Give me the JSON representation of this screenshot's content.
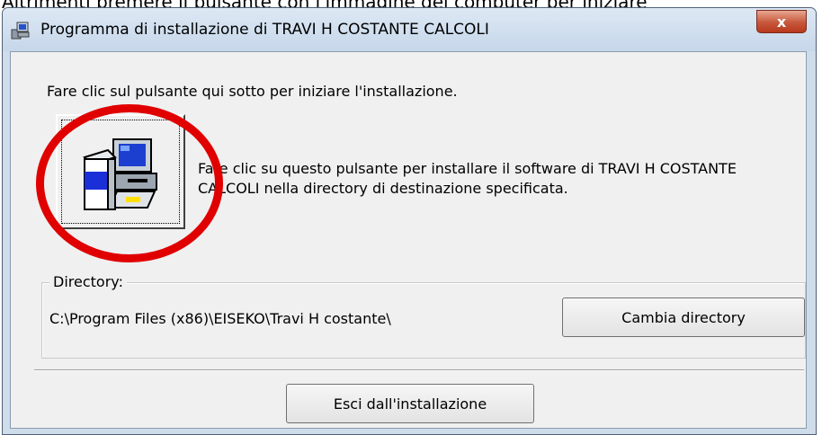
{
  "caption": "Altrimenti premere il pulsante con l'immagine del computer per iniziare",
  "window": {
    "title": "Programma di installazione di TRAVI H COSTANTE CALCOLI",
    "icon": "installer-icon",
    "close_label": "x"
  },
  "content": {
    "intro": "Fare clic sul pulsante qui sotto per iniziare l'installazione.",
    "install_button_icon": "computer-setup-icon",
    "install_description": "Fare clic su questo pulsante per installare il software di TRAVI H COSTANTE CALCOLI nella directory di destinazione specificata.",
    "directory_label": "Directory:",
    "directory_path": "C:\\Program Files (x86)\\EISEKO\\Travi H costante\\",
    "change_directory_button": "Cambia directory",
    "exit_button": "Esci dall'installazione"
  },
  "annotation": {
    "color": "#e00000",
    "shape": "ellipse"
  }
}
